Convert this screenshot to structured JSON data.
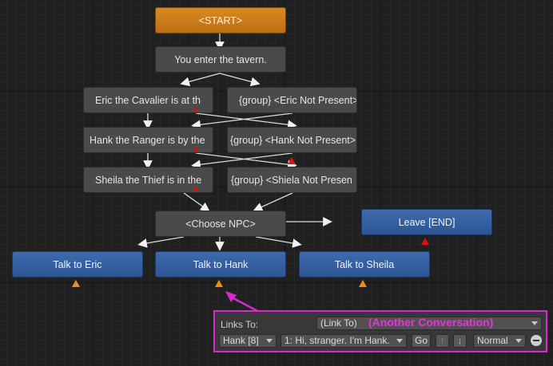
{
  "nodes": {
    "start": "<START>",
    "enter": "You enter the tavern.",
    "eric": "Eric the Cavalier is at th",
    "eric_np": "{group} <Eric Not Present>",
    "hank": "Hank the Ranger is by the",
    "hank_np": "{group} <Hank Not Present>",
    "sheila": "Sheila the Thief is in the",
    "sheila_np": "{group} <Shiela Not Presen",
    "choose": "<Choose NPC>",
    "leave": "Leave [END]",
    "talk_eric": "Talk to Eric",
    "talk_hank": "Talk to Hank",
    "talk_sheila": "Talk to Sheila"
  },
  "panel": {
    "links_to_label": "Links To:",
    "links_to_value": "(Link To)",
    "another_conversation": "(Another Conversation)",
    "conversant": "Hank [8]",
    "entry": "1: Hi, stranger. I'm Hank.",
    "go_label": "Go",
    "up_arrow": "↑",
    "down_arrow": "↓",
    "priority": "Normal"
  },
  "colors": {
    "start_node": "#cc7a1a",
    "blue_node": "#3462a6",
    "gray_node": "#4a4a4a",
    "highlight": "#d92ad0"
  }
}
